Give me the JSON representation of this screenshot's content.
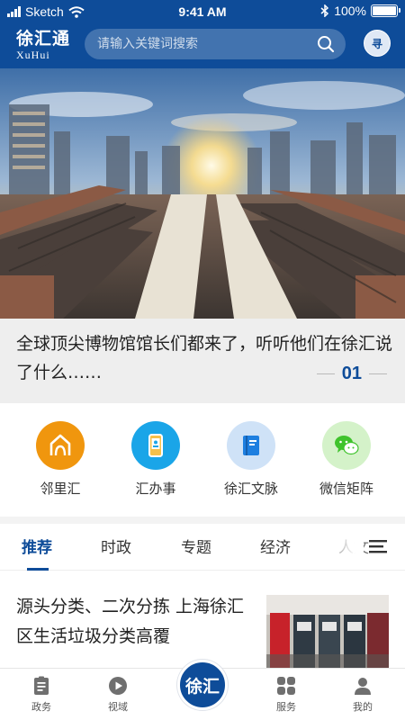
{
  "status_bar": {
    "carrier": "Sketch",
    "time": "9:41 AM",
    "battery": "100%"
  },
  "header": {
    "logo_cn": "徐汇通",
    "logo_en": "XuHui",
    "search_placeholder": "请输入关键词搜索",
    "avatar_text": "寻"
  },
  "banner": {
    "caption": "全球顶尖博物馆馆长们都来了，听听他们在徐汇说了什么……",
    "page_number": "01"
  },
  "quick_entries": [
    {
      "label": "邻里汇",
      "icon": "neighborhood-icon",
      "color": "#f0960e"
    },
    {
      "label": "汇办事",
      "icon": "phone-service-icon",
      "color": "#1aa5e8"
    },
    {
      "label": "徐汇文脉",
      "icon": "book-icon",
      "color": "#cfe2f7"
    },
    {
      "label": "微信矩阵",
      "icon": "wechat-icon",
      "color": "#d4f2c9"
    }
  ],
  "tabs": [
    "推荐",
    "时政",
    "专题",
    "经济",
    "人文"
  ],
  "active_tab": "推荐",
  "article": {
    "title": "源头分类、二次分拣 上海徐汇区生活垃圾分类高覆"
  },
  "bottom_nav": [
    {
      "label": "政务",
      "icon": "document-icon"
    },
    {
      "label": "视域",
      "icon": "play-icon"
    },
    {
      "label": "徐汇",
      "icon": "center-logo-icon"
    },
    {
      "label": "服务",
      "icon": "grid-icon"
    },
    {
      "label": "我的",
      "icon": "user-icon"
    }
  ],
  "colors": {
    "brand": "#0e4c99",
    "caption_bg": "#eeeeee",
    "active_tab": "#0e4c99"
  }
}
